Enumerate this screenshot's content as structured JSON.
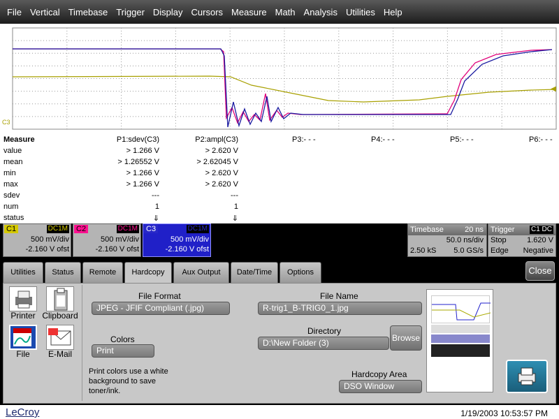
{
  "menu": [
    "File",
    "Vertical",
    "Timebase",
    "Trigger",
    "Display",
    "Cursors",
    "Measure",
    "Math",
    "Analysis",
    "Utilities",
    "Help"
  ],
  "screen": {
    "trace_colors": {
      "c1": "#a8a000",
      "c2": "#e0007a",
      "c3": "#1a1aa0"
    },
    "left_marker": "C3",
    "right_marker": "◀"
  },
  "measure": {
    "title": "Measure",
    "params": [
      "P1:sdev(C3)",
      "P2:ampl(C3)",
      "P3:- - -",
      "P4:- - -",
      "P5:- - -",
      "P6:- - -"
    ],
    "rows": [
      {
        "label": "value",
        "p1": "> 1.266 V",
        "p2": "> 2.620 V"
      },
      {
        "label": "mean",
        "p1": "> 1.26552 V",
        "p2": "> 2.62045 V"
      },
      {
        "label": "min",
        "p1": "> 1.266 V",
        "p2": "> 2.620 V"
      },
      {
        "label": "max",
        "p1": "> 1.266 V",
        "p2": "> 2.620 V"
      },
      {
        "label": "sdev",
        "p1": "---",
        "p2": "---"
      },
      {
        "label": "num",
        "p1": "1",
        "p2": "1"
      },
      {
        "label": "status",
        "p1": "⇓",
        "p2": "⇓"
      }
    ]
  },
  "channels": [
    {
      "tag": "C1",
      "coupling": "DC1M",
      "vdiv": "500 mV/div",
      "offset": "-2.160 V ofst",
      "color": "#d4c800"
    },
    {
      "tag": "C2",
      "coupling": "DC1M",
      "vdiv": "500 mV/div",
      "offset": "-2.160 V ofst",
      "color": "#ff1090"
    },
    {
      "tag": "C3",
      "coupling": "DC1M",
      "vdiv": "500 mV/div",
      "offset": "-2.160 V ofst",
      "color": "#2828c8"
    }
  ],
  "timebase": {
    "label": "Timebase",
    "value": "20 ns",
    "div": "50.0 ns/div",
    "samples": "2.50 kS",
    "rate": "5.0 GS/s"
  },
  "trigger": {
    "label": "Trigger",
    "badge": "C1 DC",
    "mode": "Stop",
    "level": "1.620 V",
    "type": "Edge",
    "slope": "Negative"
  },
  "tabs": [
    "Utilities",
    "Status",
    "Remote",
    "Hardcopy",
    "Aux Output",
    "Date/Time",
    "Options"
  ],
  "active_tab": "Hardcopy",
  "close_label": "Close",
  "hardcopy": {
    "devices": [
      "Printer",
      "Clipboard",
      "File",
      "E-Mail"
    ],
    "file_format_label": "File Format",
    "file_format": "JPEG - JFIF Compliant (.jpg)",
    "colors_label": "Colors",
    "colors": "Print",
    "note": "Print colors use a white background to save toner/ink.",
    "file_name_label": "File Name",
    "file_name": "R-trig1_B-TRIG0_1.jpg",
    "directory_label": "Directory",
    "directory": "D:\\New Folder (3)",
    "browse_label": "Browse",
    "area_label": "Hardcopy Area",
    "area": "DSO Window"
  },
  "footer": {
    "logo": "LeCroy",
    "timestamp": "1/19/2003 10:53:57 PM"
  }
}
